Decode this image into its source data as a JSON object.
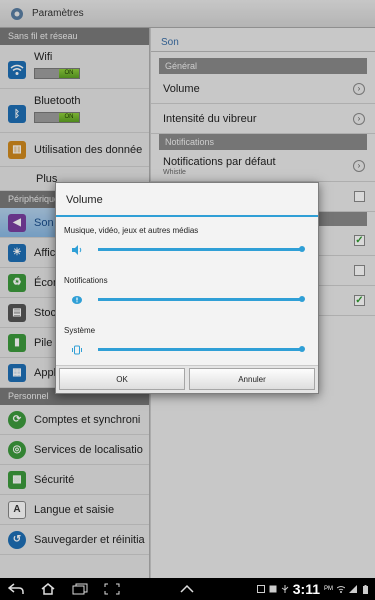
{
  "app": {
    "title": "Paramètres"
  },
  "left": {
    "sections": [
      {
        "header": "Sans fil et réseau"
      },
      {
        "header": "Périphérique"
      },
      {
        "header": "Personnel"
      }
    ],
    "wifi": {
      "label": "Wifi",
      "toggle_text": "ON"
    },
    "bluetooth": {
      "label": "Bluetooth",
      "toggle_text": "ON"
    },
    "data_usage": "Utilisation des donnée",
    "more": "Plus",
    "son": "Son",
    "affichage": "Affic",
    "economie": "Écon",
    "stockage": "Stoc",
    "pile": "Pile",
    "applications": "Appl",
    "comptes": "Comptes et synchroni",
    "localisation": "Services de localisatio",
    "securite": "Sécurité",
    "langue": "Langue et saisie",
    "sauvegarde": "Sauvegarder et réinitia"
  },
  "right": {
    "title": "Son",
    "section_general": "Général",
    "volume": "Volume",
    "vibration": "Intensité du vibreur",
    "section_notifications": "Notifications",
    "default_notif": "Notifications par défaut",
    "default_notif_value": "Whistle"
  },
  "dialog": {
    "title": "Volume",
    "rows": [
      {
        "label": "Musique, vidéo, jeux et autres médias",
        "level": 1.0
      },
      {
        "label": "Notifications",
        "level": 1.0
      },
      {
        "label": "Système",
        "level": 1.0
      }
    ],
    "ok": "OK",
    "cancel": "Annuler"
  },
  "status": {
    "time": "3:11",
    "ampm": "PM"
  },
  "colors": {
    "accent": "#2f9fd6",
    "selected_text": "#1b4f8d"
  }
}
